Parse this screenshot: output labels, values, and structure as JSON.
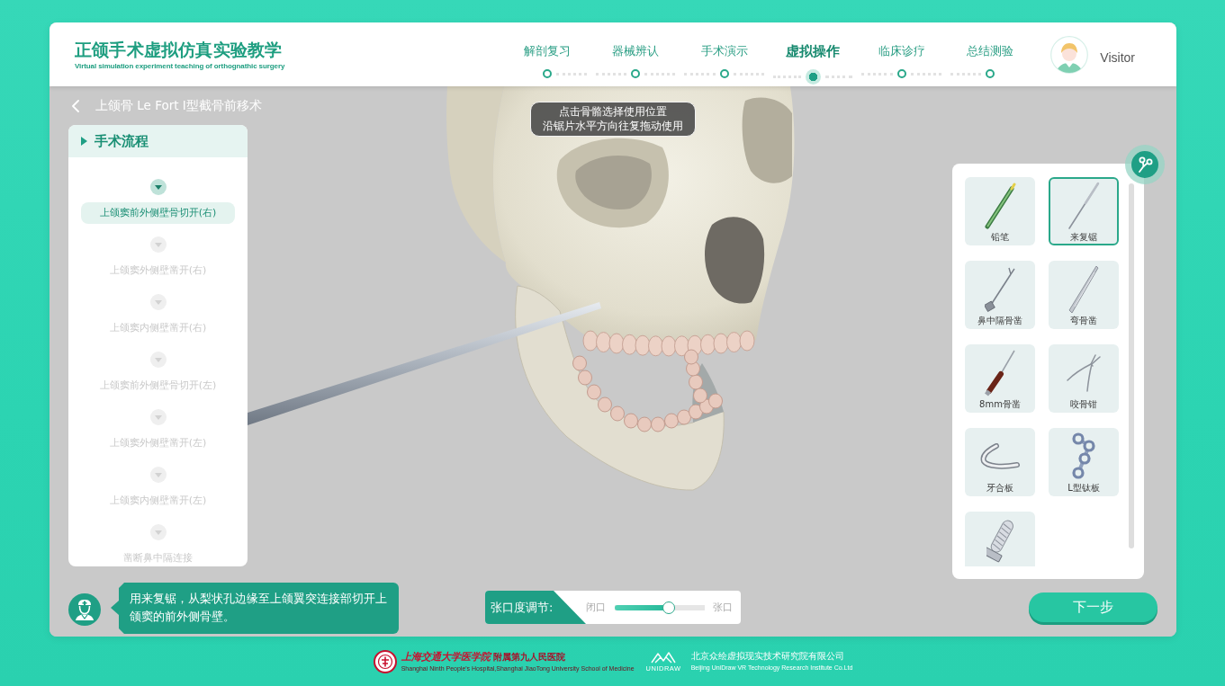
{
  "header": {
    "title": "正颌手术虚拟仿真实验教学",
    "subtitle": "Virtual simulation experiment teaching of orthognathic surgery"
  },
  "nav": [
    {
      "label": "解剖复习",
      "selected": false
    },
    {
      "label": "器械辨认",
      "selected": false
    },
    {
      "label": "手术演示",
      "selected": false
    },
    {
      "label": "虚拟操作",
      "selected": true
    },
    {
      "label": "临床诊疗",
      "selected": false
    },
    {
      "label": "总结测验",
      "selected": false
    }
  ],
  "user": {
    "name": "Visitor"
  },
  "procedure": {
    "title": "上颌骨 Le Fort I型截骨前移术"
  },
  "hint": {
    "lines": [
      "点击骨骼选择使用位置",
      "沿锯片水平方向往复拖动使用"
    ]
  },
  "steps_panel": {
    "title": "手术流程",
    "steps": [
      {
        "label": "上颌窦前外侧壁骨切开(右)",
        "selected": true,
        "disabled": false
      },
      {
        "label": "上颌窦外侧壁凿开(右)",
        "selected": false,
        "disabled": true
      },
      {
        "label": "上颌窦内侧壁凿开(右)",
        "selected": false,
        "disabled": true
      },
      {
        "label": "上颌窦前外侧壁骨切开(左)",
        "selected": false,
        "disabled": true
      },
      {
        "label": "上颌窦外侧壁凿开(左)",
        "selected": false,
        "disabled": true
      },
      {
        "label": "上颌窦内侧壁凿开(左)",
        "selected": false,
        "disabled": true
      },
      {
        "label": "凿断鼻中隔连接",
        "selected": false,
        "disabled": true
      }
    ]
  },
  "tools": [
    {
      "label": "铅笔",
      "kind": "pencil",
      "selected": false
    },
    {
      "label": "来复锯",
      "kind": "saw",
      "selected": true
    },
    {
      "label": "鼻中隔骨凿",
      "kind": "septal",
      "selected": false
    },
    {
      "label": "弯骨凿",
      "kind": "curved",
      "selected": false
    },
    {
      "label": "8mm骨凿",
      "kind": "chisel",
      "selected": false
    },
    {
      "label": "咬骨钳",
      "kind": "rongeur",
      "selected": false
    },
    {
      "label": "牙合板",
      "kind": "splint",
      "selected": false
    },
    {
      "label": "L型钛板",
      "kind": "plate",
      "selected": false
    },
    {
      "kind": "screw",
      "selected": false
    }
  ],
  "instruction": {
    "text": "用来复锯，从梨状孔边缘至上颌翼突连接部切开上颌窦的前外侧骨壁。"
  },
  "jaw_slider": {
    "label": "张口度调节:",
    "min_label": "闭口",
    "max_label": "张口",
    "level": 0.6
  },
  "next_button": {
    "label": "下一步"
  },
  "footer": {
    "hospital_logo": "上海交通大学医学院",
    "hospital_name": "附属第九人民医院",
    "hospital_subtitle": "Shanghai Ninth People's Hospital,Shanghai JiaoTong University School of Medicine",
    "partner_logo": "UNIDRAW",
    "company_name": "北京众绘虚拟现实技术研究院有限公司",
    "company_subtitle": "Beijing UniDraw VR Technology Research Institute Co.Ltd"
  }
}
